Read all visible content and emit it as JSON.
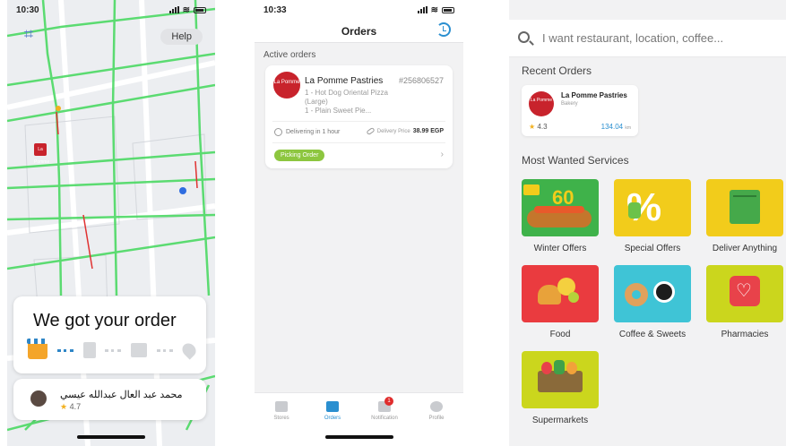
{
  "screen1": {
    "status_time": "10:30",
    "help_label": "Help",
    "store_pin_label": "La Pomme",
    "order_heading": "We got your order",
    "courier_name": "محمد عبد العال عبدالله عيسي",
    "courier_rating": "4.7",
    "colors": {
      "route": "#4cd964",
      "accent": "#2f86c7",
      "pin": "#c8232c"
    }
  },
  "screen2": {
    "status_time": "10:33",
    "title": "Orders",
    "section_label": "Active orders",
    "order": {
      "logo_text": "La Pomme",
      "store_name": "La Pomme Pastries",
      "order_number": "#256806527",
      "items": [
        "1 - Hot Dog Oriental Pizza (Large)",
        "1 - Plain Sweet Pie..."
      ],
      "delivery_time": "Delivering in 1 hour",
      "price_label": "Delivery Price",
      "price_value": "38.99 EGP",
      "status": "Picking Order"
    },
    "tabs": [
      {
        "label": "Stores",
        "icon": "stores-icon",
        "active": false
      },
      {
        "label": "Orders",
        "icon": "delivery-icon",
        "active": true
      },
      {
        "label": "Notification",
        "icon": "megaphone-icon",
        "active": false,
        "badge": "1"
      },
      {
        "label": "Profile",
        "icon": "profile-icon",
        "active": false
      }
    ]
  },
  "screen3": {
    "search_placeholder": "I want restaurant, location, coffee...",
    "recent_heading": "Recent Orders",
    "recent": {
      "logo_text": "La Pomme",
      "name": "La Pomme Pastries",
      "category": "Bakery",
      "rating": "4.3",
      "distance": "134.04",
      "distance_unit": "km"
    },
    "services_heading": "Most Wanted Services",
    "winter_tile_text": "60",
    "services": [
      {
        "label": "Winter Offers",
        "color": "#3fb24a"
      },
      {
        "label": "Special Offers",
        "color": "#f2cc1b"
      },
      {
        "label": "Deliver Anything",
        "color": "#f2cc1b"
      },
      {
        "label": "Food",
        "color": "#ea3b3f"
      },
      {
        "label": "Coffee & Sweets",
        "color": "#3fc4d6"
      },
      {
        "label": "Pharmacies",
        "color": "#cbd61d"
      },
      {
        "label": "Supermarkets",
        "color": "#cbd61d"
      }
    ]
  }
}
